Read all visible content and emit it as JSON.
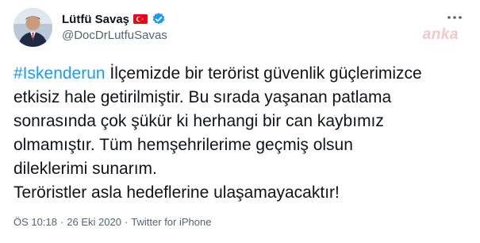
{
  "author": {
    "display_name": "Lütfü Savaş",
    "handle": "@DocDrLutfuSavas",
    "flag_icon": "turkey-flag-icon",
    "verified_icon": "verified-badge-icon",
    "verified_color": "#1d9bf0"
  },
  "watermark": "anka",
  "tweet": {
    "hashtag": "#Iskenderun",
    "line1_rest": " İlçemizde bir terörist güvenlik güçlerimizce",
    "line2": "etkisiz hale getirilmiştir. Bu sırada yaşanan patlama",
    "line3": "sonrasında çok şükür ki herhangi bir can kaybımız",
    "line4": "olmamıştır. Tüm hemşehrilerime geçmiş olsun",
    "line5": "dileklerimi sunarım.",
    "line6": "Teröristler asla hedeflerine ulaşamayacaktır!"
  },
  "meta": {
    "time": "ÖS 10:18",
    "separator1": "·",
    "date": "26 Eki 2020",
    "separator2": "·",
    "source": "Twitter for iPhone"
  },
  "colors": {
    "text": "#0f1419",
    "secondary": "#536471",
    "link": "#1d9bf0",
    "flag_red": "#e30a17"
  }
}
